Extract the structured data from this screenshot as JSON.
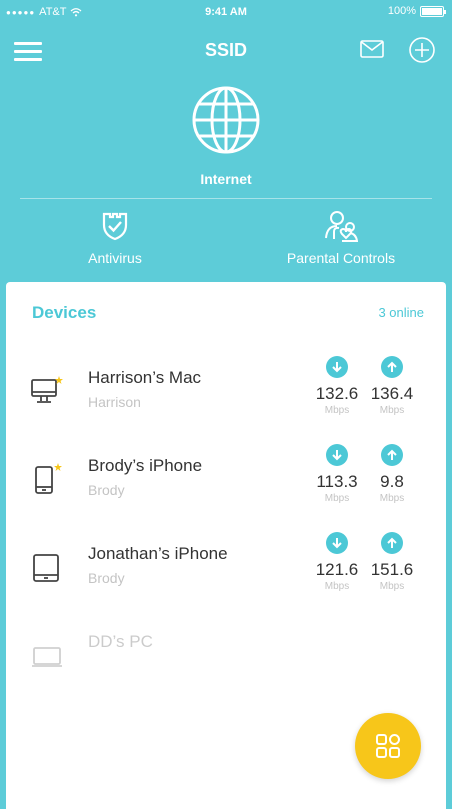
{
  "status_bar": {
    "signal_dots": "●●●●●",
    "carrier": "AT&T",
    "wifi_icon": "wifi-icon",
    "time": "9:41 AM",
    "battery_percent": "100%"
  },
  "nav": {
    "title": "SSID",
    "menu_icon": "hamburger-menu-icon",
    "mail_icon": "mail-icon",
    "add_icon": "add-circle-icon"
  },
  "internet": {
    "label": "Internet",
    "icon": "globe-icon"
  },
  "features": [
    {
      "label": "Antivirus",
      "icon": "shield-icon"
    },
    {
      "label": "Parental Controls",
      "icon": "parental-controls-icon"
    }
  ],
  "devices_card": {
    "title": "Devices",
    "online_count": "3 online",
    "devices": [
      {
        "name": "Harrison’s Mac",
        "owner": "Harrison",
        "type": "desktop-icon",
        "new_badge": true,
        "download": "132.6",
        "upload": "136.4",
        "unit": "Mbps"
      },
      {
        "name": "Brody’s iPhone",
        "owner": "Brody",
        "type": "phone-icon",
        "new_badge": true,
        "download": "113.3",
        "upload": "9.8",
        "unit": "Mbps"
      },
      {
        "name": "Jonathan’s iPhone",
        "owner": "Brody",
        "type": "tablet-icon",
        "new_badge": false,
        "download": "121.6",
        "upload": "151.6",
        "unit": "Mbps"
      },
      {
        "name": "DD’s PC",
        "owner": "",
        "type": "laptop-icon",
        "new_badge": false,
        "download": "",
        "upload": "",
        "unit": ""
      }
    ]
  },
  "fab": {
    "icon": "apps-grid-icon"
  },
  "colors": {
    "header_bg": "#5dccd8",
    "accent": "#4cc8d6",
    "fab": "#f7c61a",
    "badge": "#f7c61a"
  }
}
